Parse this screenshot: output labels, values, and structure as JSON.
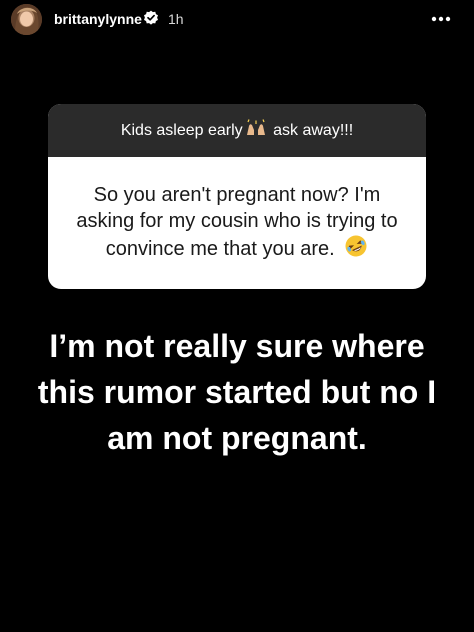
{
  "header": {
    "username": "brittanylynne",
    "time": "1h",
    "avatar_icon": "profile-avatar",
    "verified_icon": "verified-badge-icon",
    "more_icon": "more-dots-icon"
  },
  "sticker": {
    "prompt_before": "Kids asleep early",
    "prompt_after": " ask away!!!",
    "prompt_emoji": "raising-hands-icon",
    "question": "So you aren't pregnant now? I'm asking for my cousin who is trying to convince me that you are.",
    "question_emoji": "rolling-laughing-icon"
  },
  "answer": "I’m not really sure where this rumor started but no I am not pregnant.",
  "colors": {
    "background": "#000000",
    "sticker_header": "#2b2b2b",
    "sticker_body": "#ffffff",
    "text_dark": "#1a1a1a"
  }
}
